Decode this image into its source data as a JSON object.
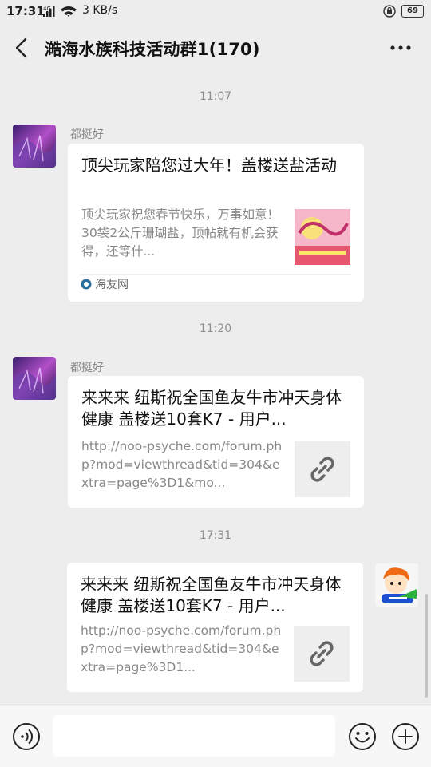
{
  "status_bar": {
    "time": "17:31",
    "network_speed": "3 KB/s",
    "signal": "4G",
    "battery": "69"
  },
  "header": {
    "title": "澔海水族科技活动群1(170)"
  },
  "messages": [
    {
      "timestamp": "11:07",
      "sender": "都挺好",
      "title": "顶尖玩家陪您过大年！盖楼送盐活动",
      "description": "顶尖玩家祝您春节快乐，万事如意！30袋2公斤珊瑚盐，顶帖就有机会获得，还等什...",
      "source": "海友网"
    },
    {
      "timestamp": "11:20",
      "sender": "都挺好",
      "title": "来来来 纽斯祝全国鱼友牛市冲天身体健康 盖楼送10套K7 - 用户...",
      "link": "http://noo-psyche.com/forum.php?mod=viewthread&tid=304&extra=page%3D1&mo..."
    },
    {
      "timestamp": "17:31",
      "title": "来来来 纽斯祝全国鱼友牛市冲天身体健康 盖楼送10套K7 - 用户...",
      "link": "http://noo-psyche.com/forum.php?mod=viewthread&tid=304&extra=page%3D1..."
    }
  ],
  "colors": {
    "background": "#ededed",
    "card": "#ffffff",
    "meta_text": "#888888"
  }
}
